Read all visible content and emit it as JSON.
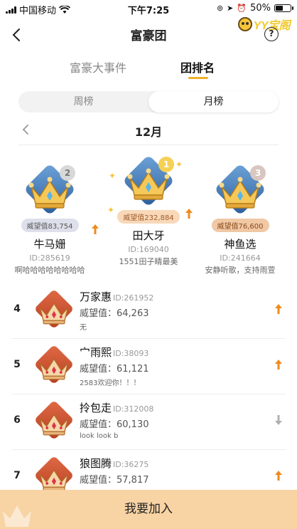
{
  "status_bar": {
    "carrier": "中国移动",
    "time": "下午7:25",
    "battery": "50%",
    "battery_level": 0.5
  },
  "brand": {
    "logo_text": "YY宝阁"
  },
  "nav": {
    "title": "富豪团",
    "help": "?"
  },
  "tabs": [
    {
      "label": "富豪大事件",
      "active": false
    },
    {
      "label": "团排名",
      "active": true
    }
  ],
  "segment": {
    "week": "周榜",
    "month": "月榜",
    "active": "month"
  },
  "month_label": "12月",
  "podium": [
    {
      "rank": "2",
      "score": "威望值83,754",
      "name": "牛马姗",
      "id": "ID:285619",
      "desc": "啊哈哈哈哈哈哈哈哈",
      "trend": "up"
    },
    {
      "rank": "1",
      "score": "威望值232,884",
      "name": "田大牙",
      "id": "ID:169040",
      "desc": "1551田子睛最美",
      "trend": "up"
    },
    {
      "rank": "3",
      "score": "威望值76,600",
      "name": "神鱼选",
      "id": "ID:241664",
      "desc": "安静听歌，支持雨萱",
      "trend": "none"
    }
  ],
  "rows": [
    {
      "rank": "4",
      "name": "万家惠",
      "id": "ID:261952",
      "score": "威望值：64,263",
      "desc": "无",
      "trend": "up"
    },
    {
      "rank": "5",
      "name": "宀雨熙",
      "id": "ID:38093",
      "score": "威望值：61,121",
      "desc": "2583欢迎你！！！",
      "trend": "up"
    },
    {
      "rank": "6",
      "name": "拎包走",
      "id": "ID:312008",
      "score": "威望值：60,130",
      "desc": "look look b",
      "trend": "down"
    },
    {
      "rank": "7",
      "name": "狼图腾",
      "id": "ID:36275",
      "score": "威望值：57,817",
      "desc": "",
      "trend": "up"
    }
  ],
  "join_button": "我要加入",
  "colors": {
    "accent": "#f3b12a",
    "up_arrow": "#f08a1c",
    "down_arrow": "#b0b0b0",
    "join_bg": "#f8d3a4"
  }
}
